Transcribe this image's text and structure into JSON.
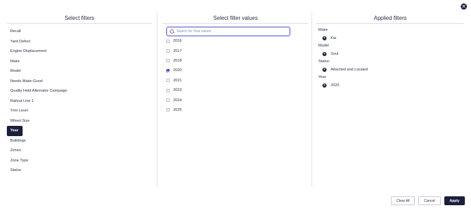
{
  "close_symbol": "✕",
  "select_filters": {
    "title": "Select filters",
    "items": [
      {
        "label": "Recall",
        "active": false
      },
      {
        "label": "Yard Defect",
        "active": false
      },
      {
        "label": "Engine Displacement",
        "active": false
      },
      {
        "label": "Make",
        "active": false
      },
      {
        "label": "Model",
        "active": false
      },
      {
        "label": "Needs Make-Good",
        "active": false
      },
      {
        "label": "Quality Hold Alternator Campaign",
        "active": false
      },
      {
        "label": "Railout Line 1",
        "active": false
      },
      {
        "label": "Trim Level",
        "active": false
      },
      {
        "label": "Wheel Size",
        "active": false
      },
      {
        "label": "Year",
        "active": true
      },
      {
        "label": "Buildings",
        "active": false
      },
      {
        "label": "Zones",
        "active": false
      },
      {
        "label": "Zone Type",
        "active": false
      },
      {
        "label": "Status",
        "active": false
      }
    ]
  },
  "filter_values": {
    "title": "Select filter values",
    "search": {
      "placeholder": "Search for Year values",
      "value": ""
    },
    "values": [
      {
        "label": "2016",
        "checked": false
      },
      {
        "label": "2017",
        "checked": false
      },
      {
        "label": "2018",
        "checked": false
      },
      {
        "label": "2020",
        "checked": true
      },
      {
        "label": "2021",
        "checked": false
      },
      {
        "label": "2023",
        "checked": false
      },
      {
        "label": "2024",
        "checked": false
      },
      {
        "label": "2025",
        "checked": false
      }
    ]
  },
  "applied_filters": {
    "title": "Applied filters",
    "remove_symbol": "✕",
    "groups": [
      {
        "name": "Make",
        "values": [
          "Kia"
        ]
      },
      {
        "name": "Model",
        "values": [
          "Soul"
        ]
      },
      {
        "name": "Status",
        "values": [
          "Attached and Located"
        ]
      },
      {
        "name": "Year",
        "values": [
          "2020"
        ]
      }
    ]
  },
  "footer": {
    "clear_all_label": "Clear All",
    "cancel_label": "Cancel",
    "apply_label": "Apply"
  },
  "colors": {
    "primary": "#1b1f3b",
    "accent": "#4a4fc4"
  }
}
